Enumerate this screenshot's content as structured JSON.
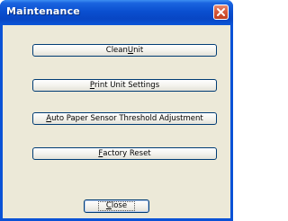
{
  "window": {
    "title": "Maintenance",
    "close_glyph": "✕"
  },
  "buttons": [
    {
      "before": "Clean ",
      "mnemonic": "U",
      "after": "nit"
    },
    {
      "before": "",
      "mnemonic": "P",
      "after": "rint Unit Settings"
    },
    {
      "before": "",
      "mnemonic": "A",
      "after": "uto Paper Sensor Threshold Adjustment"
    },
    {
      "before": "",
      "mnemonic": "F",
      "after": "actory Reset"
    }
  ],
  "close_button": {
    "before": "",
    "mnemonic": "C",
    "after": "lose"
  },
  "colors": {
    "titlebar": "#0a4fd0",
    "client": "#ece9d8",
    "button_border": "#003c74",
    "close_red": "#d65a3c"
  },
  "icons": {
    "close": "close-x-icon"
  }
}
